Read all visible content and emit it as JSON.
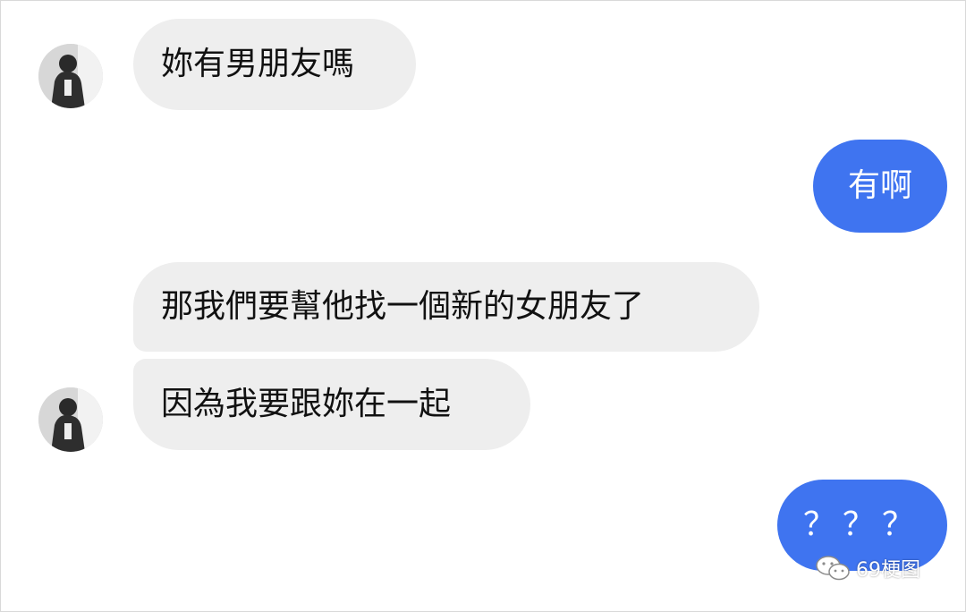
{
  "conversation": {
    "messages": [
      {
        "side": "incoming",
        "text": "妳有男朋友嗎"
      },
      {
        "side": "outgoing",
        "text": "有啊"
      },
      {
        "side": "incoming",
        "text": "那我們要幫他找一個新的女朋友了"
      },
      {
        "side": "incoming",
        "text": "因為我要跟妳在一起"
      },
      {
        "side": "outgoing",
        "text": "？？？"
      }
    ]
  },
  "watermark": {
    "text": "69梗图",
    "icon": "wechat-icon"
  },
  "colors": {
    "outgoing_bubble": "#3f74f0",
    "incoming_bubble": "#eeeeee",
    "background": "#ffffff"
  }
}
